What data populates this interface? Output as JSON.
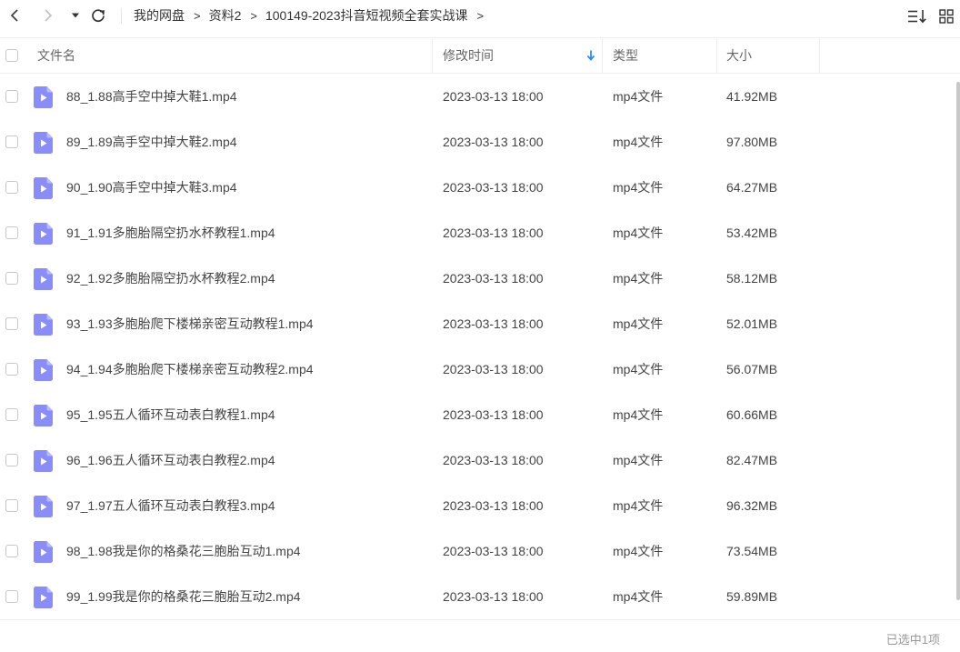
{
  "breadcrumb": [
    "我的网盘",
    "资料2",
    "100149-2023抖音短视频全套实战课"
  ],
  "header": {
    "name": "文件名",
    "modified": "修改时间",
    "type": "类型",
    "size": "大小"
  },
  "files": [
    {
      "name": "88_1.88高手空中掉大鞋1.mp4",
      "modified": "2023-03-13 18:00",
      "type": "mp4文件",
      "size": "41.92MB"
    },
    {
      "name": "89_1.89高手空中掉大鞋2.mp4",
      "modified": "2023-03-13 18:00",
      "type": "mp4文件",
      "size": "97.80MB"
    },
    {
      "name": "90_1.90高手空中掉大鞋3.mp4",
      "modified": "2023-03-13 18:00",
      "type": "mp4文件",
      "size": "64.27MB"
    },
    {
      "name": "91_1.91多胞胎隔空扔水杯教程1.mp4",
      "modified": "2023-03-13 18:00",
      "type": "mp4文件",
      "size": "53.42MB"
    },
    {
      "name": "92_1.92多胞胎隔空扔水杯教程2.mp4",
      "modified": "2023-03-13 18:00",
      "type": "mp4文件",
      "size": "58.12MB"
    },
    {
      "name": "93_1.93多胞胎爬下楼梯亲密互动教程1.mp4",
      "modified": "2023-03-13 18:00",
      "type": "mp4文件",
      "size": "52.01MB"
    },
    {
      "name": "94_1.94多胞胎爬下楼梯亲密互动教程2.mp4",
      "modified": "2023-03-13 18:00",
      "type": "mp4文件",
      "size": "56.07MB"
    },
    {
      "name": "95_1.95五人循环互动表白教程1.mp4",
      "modified": "2023-03-13 18:00",
      "type": "mp4文件",
      "size": "60.66MB"
    },
    {
      "name": "96_1.96五人循环互动表白教程2.mp4",
      "modified": "2023-03-13 18:00",
      "type": "mp4文件",
      "size": "82.47MB"
    },
    {
      "name": "97_1.97五人循环互动表白教程3.mp4",
      "modified": "2023-03-13 18:00",
      "type": "mp4文件",
      "size": "96.32MB"
    },
    {
      "name": "98_1.98我是你的格桑花三胞胎互动1.mp4",
      "modified": "2023-03-13 18:00",
      "type": "mp4文件",
      "size": "73.54MB"
    },
    {
      "name": "99_1.99我是你的格桑花三胞胎互动2.mp4",
      "modified": "2023-03-13 18:00",
      "type": "mp4文件",
      "size": "59.89MB"
    }
  ],
  "status": "已选中1项",
  "icons": {
    "back": "chevron-left-icon",
    "forward": "chevron-right-icon",
    "history": "triangle-down-icon",
    "refresh": "refresh-icon",
    "sort": "sort-list-icon",
    "grid": "grid-view-icon",
    "file": "video-file-icon"
  },
  "colors": {
    "file_icon": "#8b8df6",
    "sort_arrow": "#2d8cf0"
  }
}
